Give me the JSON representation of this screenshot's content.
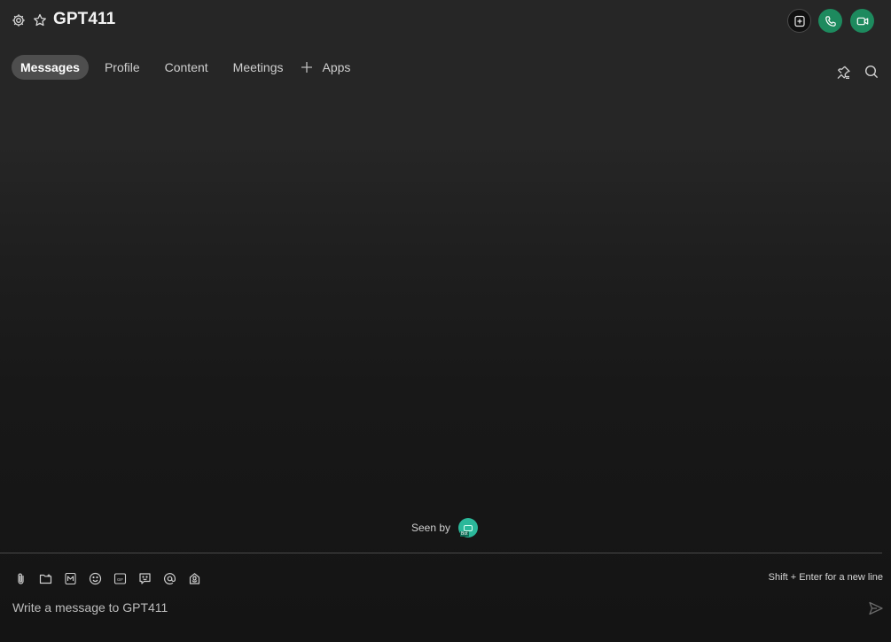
{
  "header": {
    "title": "GPT411",
    "settings_icon": "gear-icon",
    "favorite_icon": "star-icon",
    "actions": [
      {
        "name": "new-meeting",
        "icon": "add-square-icon"
      },
      {
        "name": "audio-call",
        "icon": "phone-icon"
      },
      {
        "name": "video-call",
        "icon": "video-camera-icon"
      }
    ],
    "accent_color": "#1d8a5e"
  },
  "tabs": [
    {
      "label": "Messages",
      "active": true
    },
    {
      "label": "Profile",
      "active": false
    },
    {
      "label": "Content",
      "active": false
    },
    {
      "label": "Meetings",
      "active": false
    },
    {
      "label": "Apps",
      "active": false,
      "icon": "plus-icon"
    }
  ],
  "toolbar_right": [
    {
      "name": "pinned-messages",
      "icon": "pin-icon"
    },
    {
      "name": "search",
      "icon": "search-icon"
    }
  ],
  "seen": {
    "label": "Seen by",
    "avatar_tag": "Bot"
  },
  "composer": {
    "tools": [
      {
        "name": "attach-file",
        "icon": "paperclip-icon"
      },
      {
        "name": "share-folder",
        "icon": "folder-icon"
      },
      {
        "name": "markdown",
        "icon": "markdown-icon"
      },
      {
        "name": "emoji",
        "icon": "smiley-icon"
      },
      {
        "name": "gif",
        "icon": "gif-icon"
      },
      {
        "name": "reaction",
        "icon": "chat-bubble-icon"
      },
      {
        "name": "mention",
        "icon": "at-icon"
      },
      {
        "name": "voice",
        "icon": "microphone-icon"
      }
    ],
    "hint": "Shift + Enter for a new line",
    "placeholder": "Write a message to GPT411",
    "value": "",
    "send_icon": "send-icon"
  }
}
